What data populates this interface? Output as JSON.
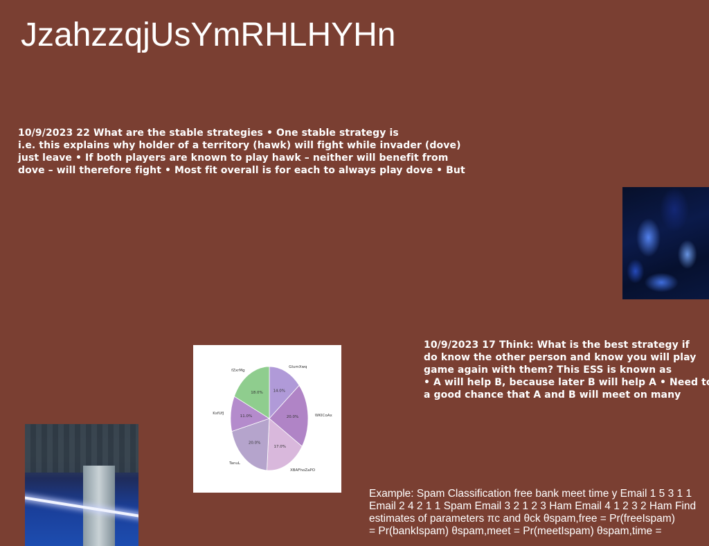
{
  "title": "JzahzzqjUsYmRHLHYHn",
  "text_block_1": {
    "lines": [
      "10/9/2023 22 What are the stable strategies • One stable strategy is",
      "i.e. this explains why holder of a territory (hawk) will fight while invader (dove)",
      "just leave • If both players are known to play hawk – neither will benefit from",
      "dove – will therefore fight • Most fit overall is for each to always play dove • But"
    ]
  },
  "text_block_2": {
    "lines": [
      "10/9/2023 17 Think: What is the best strategy if",
      "do know the other person and know you will play",
      "game again with them? This ESS is known as",
      "• A will help B, because later B will help A • Need to",
      "a good chance that A and B will meet on many"
    ]
  },
  "text_block_3": {
    "lines": [
      "Example: Spam Classification free bank meet time y Email 1 5 3 1 1",
      "Email 2 4 2 1 1 Spam Email 3 2 1 2 3 Ham Email 4 1 2 3 2 Ham Find",
      "estimates of parameters πc and θck θspam,free = Pr(freeIspam)",
      "= Pr(bankIspam) θspam,meet = Pr(meetIspam) θspam,time ="
    ]
  },
  "chart_data": {
    "type": "pie",
    "categories": [
      "GlumXwq",
      "WKICoAx",
      "XBAFhoZaPO",
      "TanuL",
      "KsfUfJ",
      "fZxrMg"
    ],
    "values": [
      14.0,
      20.0,
      17.0,
      20.0,
      11.0,
      18.0
    ],
    "labels": [
      "14.0%",
      "20.0%",
      "17.0%",
      "20.0%",
      "11.0%",
      "18.0%"
    ],
    "colors": [
      "#b09ad8",
      "#b084c6",
      "#d9b8dc",
      "#b5a4cc",
      "#b48bcc",
      "#8fcd8e"
    ],
    "title": ""
  }
}
